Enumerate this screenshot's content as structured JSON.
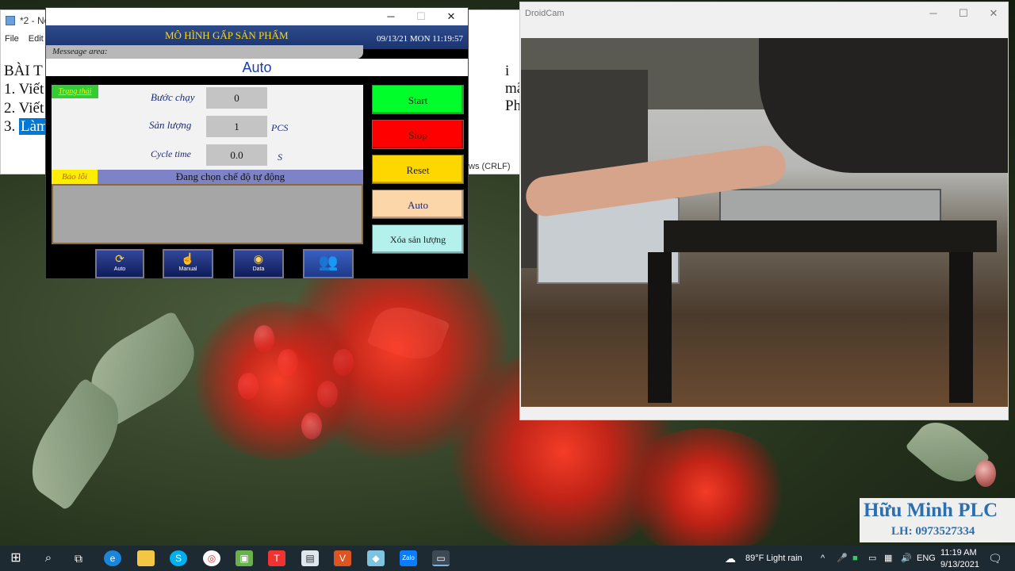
{
  "notepad": {
    "title": "*2 - No",
    "menu": [
      "File",
      "Edit"
    ],
    "lines": [
      "BÀI T",
      "1. Viết",
      "2. Viết"
    ],
    "selected_line_prefix": "3.",
    "selected_text": "Làm",
    "right_fragment": "i mã) Ph",
    "status": "ws (CRLF)"
  },
  "hmi": {
    "window_title": "",
    "title": "MÔ HÌNH GẤP SẢN PHẨM",
    "datetime": "09/13/21 MON 11:19:57",
    "message_label": "Messeage area:",
    "mode": "Auto",
    "status_tag": "Trạng thái",
    "fields": [
      {
        "label": "Bước chạy",
        "value": "0",
        "unit": ""
      },
      {
        "label": "Sản lượng",
        "value": "1",
        "unit": "PCS"
      },
      {
        "label": "Cycle time",
        "value": "0.0",
        "unit": "S"
      }
    ],
    "error_tag": "Báo lỗi",
    "error_text": "Đang chọn chế độ tự động",
    "buttons": [
      {
        "label": "Start",
        "color": "#00ff2a"
      },
      {
        "label": "Stop",
        "color": "#ff0000"
      },
      {
        "label": "Reset",
        "color": "#ffd700"
      },
      {
        "label": "Auto",
        "color": "#fcd5a8"
      },
      {
        "label": "Xóa sản lượng",
        "color": "#b4f0ec"
      }
    ],
    "nav": [
      {
        "label": "Auto",
        "icon": "refresh-icon"
      },
      {
        "label": "Manual",
        "icon": "hand-icon"
      },
      {
        "label": "Data",
        "icon": "disk-icon"
      },
      {
        "label": "",
        "icon": "users-icon"
      }
    ]
  },
  "droidcam": {
    "title": "DroidCam"
  },
  "watermark": {
    "name": "Hữu Minh PLC",
    "contact": "LH: 0973527334"
  },
  "taskbar": {
    "weather": "89°F  Light rain",
    "language": "ENG",
    "time": "11:19 AM",
    "date": "9/13/2021",
    "apps": [
      "windows-icon",
      "search-icon",
      "task-view-icon",
      "edge-icon",
      "explorer-icon",
      "skype-icon",
      "chrome-icon",
      "android-icon",
      "app-red-icon",
      "app-blue-icon",
      "app-v-icon",
      "app-cube-icon",
      "zalo-icon",
      "app-window-icon"
    ]
  }
}
